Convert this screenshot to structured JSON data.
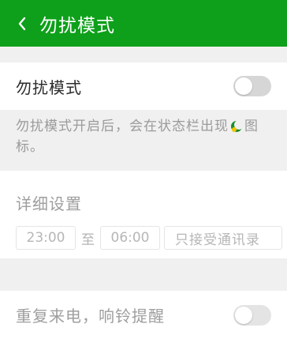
{
  "header": {
    "title": "勿扰模式",
    "back_icon": "chevron-left-icon"
  },
  "dnd": {
    "label": "勿扰模式",
    "enabled": false
  },
  "description": {
    "text_before": "勿扰模式开启后，会在状态栏出现",
    "text_after": "图标。",
    "icon": "moon-status-icon"
  },
  "details": {
    "title": "详细设置",
    "start_time": "23:00",
    "to_label": "至",
    "end_time": "06:00",
    "mode_value": "只接受通讯录"
  },
  "repeat_call": {
    "label": "重复来电，响铃提醒",
    "enabled": false
  },
  "colors": {
    "header_bg": "#0ea01a",
    "background": "#f0f0f0"
  }
}
